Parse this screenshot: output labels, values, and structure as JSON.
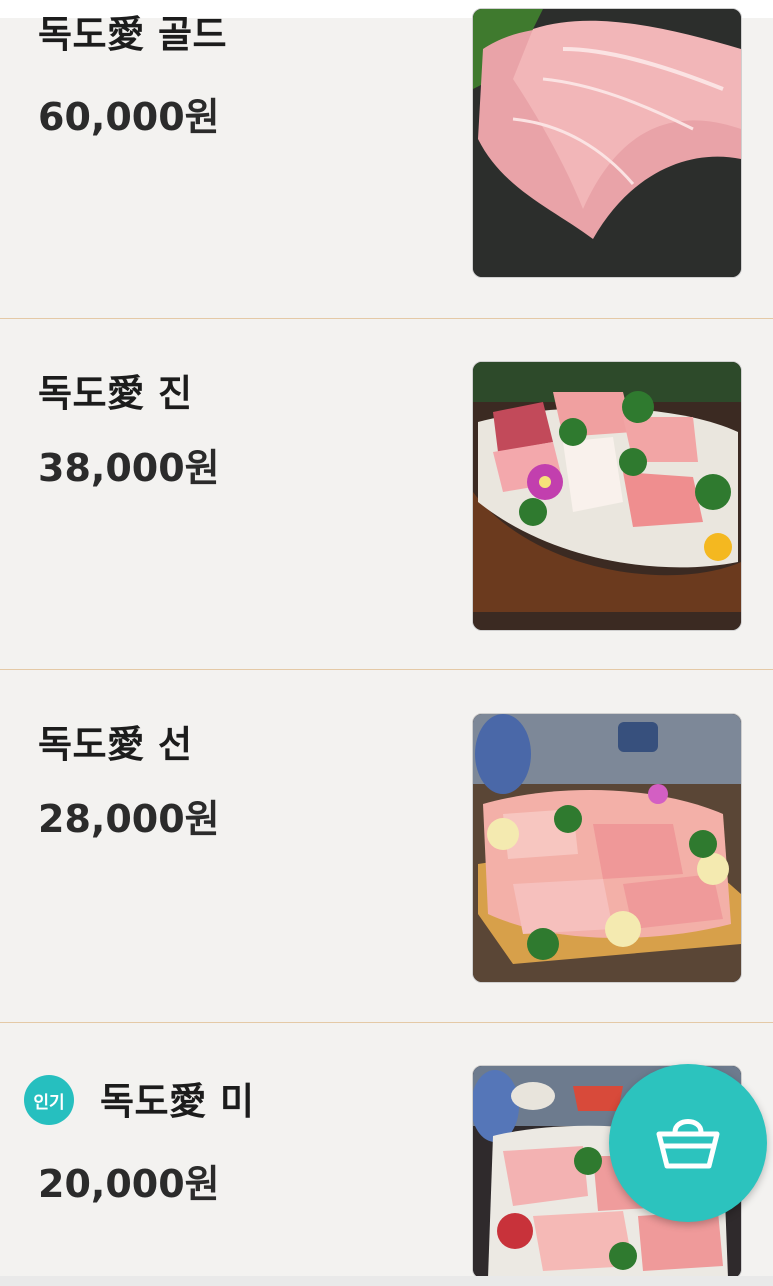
{
  "menu": {
    "items": [
      {
        "name": "독도愛 골드",
        "price": "60,000원",
        "image": "tuna-slices-photo",
        "popular": false
      },
      {
        "name": "독도愛 진",
        "price": "38,000원",
        "image": "sashimi-boat-photo",
        "popular": false
      },
      {
        "name": "독도愛 선",
        "price": "28,000원",
        "image": "sashimi-platter-photo",
        "popular": false
      },
      {
        "name": "독도愛 미",
        "price": "20,000원",
        "image": "sashimi-plate-photo",
        "popular": true
      }
    ],
    "popular_badge": "인기"
  },
  "cart_button": {
    "icon": "shopping-basket-icon"
  },
  "colors": {
    "accent": "#2cc3be",
    "divider": "#e4c9a6",
    "background": "#f3f2f0"
  }
}
